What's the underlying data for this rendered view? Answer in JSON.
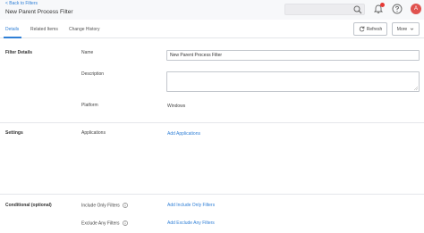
{
  "header": {
    "back_link": "< Back to Filters",
    "title": "New Parent Process Filter",
    "avatar_initial": "A"
  },
  "tabs": [
    {
      "label": "Details",
      "active": true
    },
    {
      "label": "Related Items",
      "active": false
    },
    {
      "label": "Change History",
      "active": false
    }
  ],
  "toolbar": {
    "refresh_label": "Refresh",
    "more_label": "More"
  },
  "filter_details": {
    "section_label": "Filter Details",
    "name_label": "Name",
    "name_value": "New Parent Process Filter",
    "description_label": "Description",
    "description_value": "",
    "platform_label": "Platform",
    "platform_value": "Windows"
  },
  "settings": {
    "section_label": "Settings",
    "applications_label": "Applications",
    "add_applications_link": "Add Applications"
  },
  "conditional": {
    "section_label": "Conditional (optional)",
    "include_label": "Include Only Filters",
    "include_link": "Add Include Only Filters",
    "exclude_label": "Exclude Any Filters",
    "exclude_link": "Add Exclude Any Filters"
  },
  "colors": {
    "accent": "#2f7fd6",
    "badge": "#e53935",
    "avatar": "#e0524f"
  }
}
